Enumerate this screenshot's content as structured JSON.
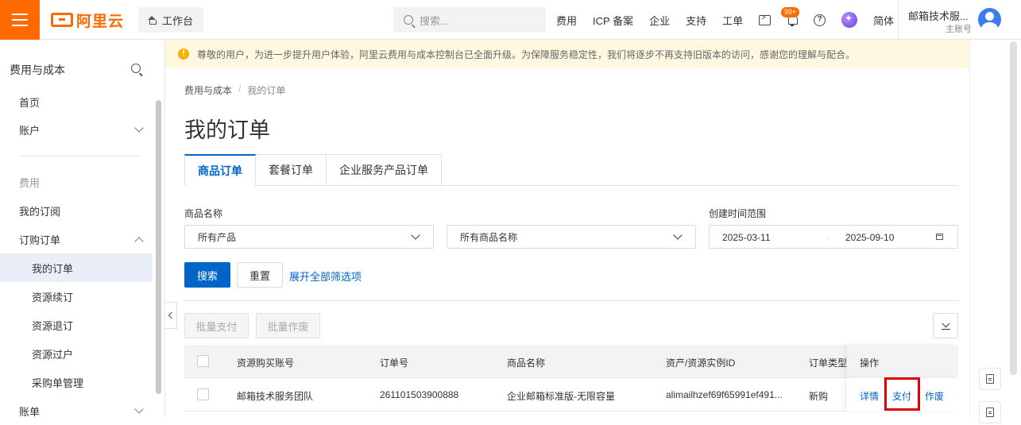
{
  "topbar": {
    "logo_text": "阿里云",
    "workbench_label": "工作台",
    "search_placeholder": "搜索...",
    "nav": [
      "费用",
      "ICP 备案",
      "企业",
      "支持",
      "工单"
    ],
    "badge": "99+",
    "lang": "简体",
    "user_name": "邮箱技术服...",
    "user_role": "主账号"
  },
  "sidebar": {
    "title": "费用与成本",
    "items": [
      {
        "label": "首页"
      },
      {
        "label": "账户"
      },
      {
        "label": "费用"
      },
      {
        "label": "我的订阅"
      },
      {
        "label": "订购订单"
      },
      {
        "label": "我的订单"
      },
      {
        "label": "资源续订"
      },
      {
        "label": "资源退订"
      },
      {
        "label": "资源过户"
      },
      {
        "label": "采购单管理"
      },
      {
        "label": "账单"
      }
    ]
  },
  "notice": "尊敬的用户，为进一步提升用户体验，阿里云费用与成本控制台已全面升级。为保障服务稳定性，我们将逐步不再支持旧版本的访问，感谢您的理解与配合。",
  "breadcrumb": [
    "费用与成本",
    "我的订单"
  ],
  "page_title": "我的订单",
  "tabs": [
    "商品订单",
    "套餐订单",
    "企业服务产品订单"
  ],
  "filters": {
    "product_label": "商品名称",
    "product_value": "所有产品",
    "product_name_value": "所有商品名称",
    "date_label": "创建时间范围",
    "date_start": "2025-03-11",
    "date_end": "2025-09-10"
  },
  "buttons": {
    "search": "搜索",
    "reset": "重置",
    "expand": "展开全部筛选项",
    "batch_pay": "批量支付",
    "batch_void": "批量作废"
  },
  "table": {
    "headers": [
      "资源购买账号",
      "订单号",
      "商品名称",
      "资产/资源实例ID",
      "订单类型",
      "操作"
    ],
    "rows": [
      {
        "account": "邮箱技术服务团队",
        "order_no": "261101503900888",
        "product": "企业邮箱标准版-无限容量",
        "instance_id": "alimailhzef69f65991ef491...",
        "type": "新购",
        "ops": [
          "详情",
          "支付",
          "作废"
        ]
      }
    ]
  }
}
